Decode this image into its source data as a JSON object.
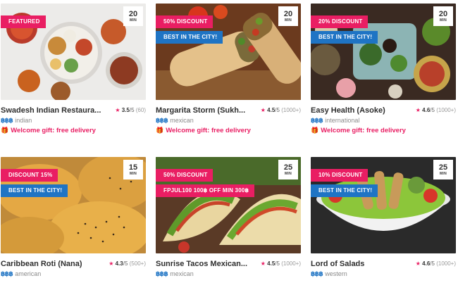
{
  "restaurants": [
    {
      "name": "Swadesh Indian Restaura...",
      "time": "20",
      "time_unit": "MIN",
      "badges": [
        "FEATURED"
      ],
      "rating": "3.5",
      "rating_scale": "/5",
      "rating_count": "(60)",
      "price": "฿฿฿",
      "cuisine": "indian",
      "gift": "Welcome gift: free delivery",
      "image": "indian-thali-icon"
    },
    {
      "name": "Margarita Storm (Sukh...",
      "time": "20",
      "time_unit": "MIN",
      "badges": [
        "50% DISCOUNT",
        "BEST IN THE CITY!"
      ],
      "rating": "4.5",
      "rating_scale": "/5",
      "rating_count": "(1000+)",
      "price": "฿฿฿",
      "cuisine": "mexican",
      "gift": "Welcome gift: free delivery",
      "image": "burrito-icon"
    },
    {
      "name": "Easy Health (Asoke)",
      "time": "20",
      "time_unit": "MIN",
      "badges": [
        "20% DISCOUNT",
        "BEST IN THE CITY!"
      ],
      "rating": "4.6",
      "rating_scale": "/5",
      "rating_count": "(1000+)",
      "price": "฿฿฿",
      "cuisine": "international",
      "gift": "Welcome gift: free delivery",
      "image": "healthy-bowls-icon"
    },
    {
      "name": "Caribbean Roti (Nana)",
      "time": "15",
      "time_unit": "MIN",
      "badges": [
        "DISCOUNT 15%",
        "BEST IN THE CITY!"
      ],
      "rating": "4.3",
      "rating_scale": "/5",
      "rating_count": "(500+)",
      "price": "฿฿฿",
      "cuisine": "american",
      "gift": "",
      "image": "empanada-icon"
    },
    {
      "name": "Sunrise Tacos Mexican...",
      "time": "25",
      "time_unit": "MIN",
      "badges": [
        "50% DISCOUNT",
        "FPJUL100 100฿ OFF MIN 300฿"
      ],
      "rating": "4.5",
      "rating_scale": "/5",
      "rating_count": "(1000+)",
      "price": "฿฿฿",
      "cuisine": "mexican",
      "gift": "",
      "image": "tacos-icon"
    },
    {
      "name": "Lord of Salads",
      "time": "25",
      "time_unit": "MIN",
      "badges": [
        "10% DISCOUNT",
        "BEST IN THE CITY!"
      ],
      "rating": "4.6",
      "rating_scale": "/5",
      "rating_count": "(1000+)",
      "price": "฿฿฿",
      "cuisine": "western",
      "gift": "",
      "image": "salad-bowl-icon"
    }
  ],
  "colors": {
    "accent": "#e91e63",
    "blue": "#1f74c4"
  }
}
